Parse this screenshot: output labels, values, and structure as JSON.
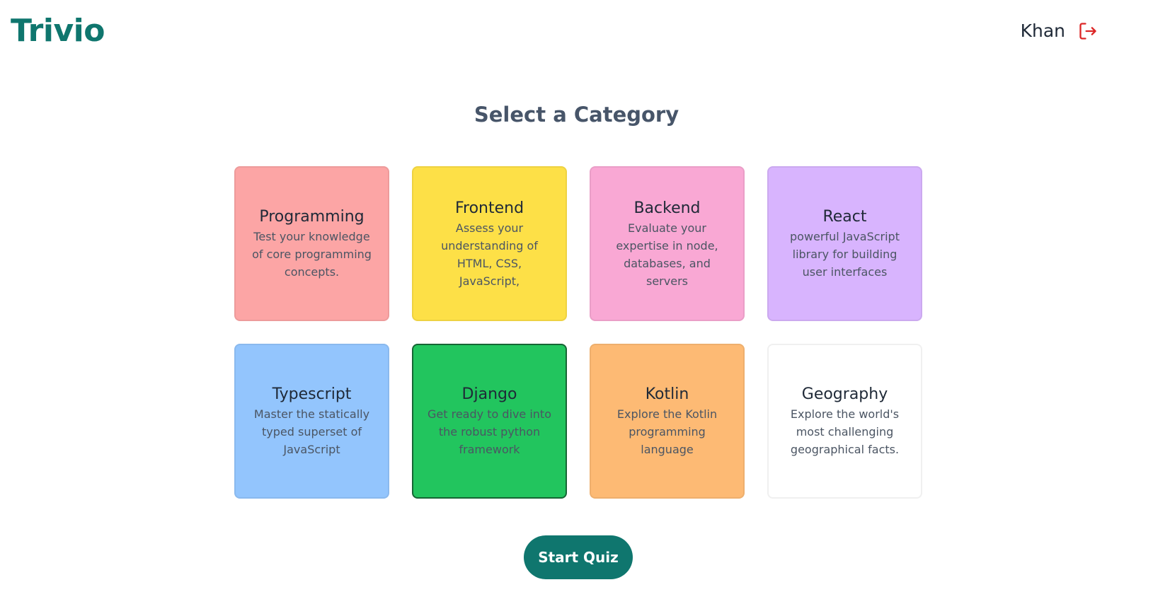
{
  "header": {
    "logo": "Trivio",
    "user_name": "Khan",
    "logout_icon": "logout-icon",
    "logo_color": "#0f766e",
    "logout_color": "#dc2626"
  },
  "main": {
    "title": "Select a Category",
    "categories": [
      {
        "title": "Programming",
        "description": "Test your knowledge of core programming concepts.",
        "color": "#fca5a5",
        "selected": false
      },
      {
        "title": "Frontend",
        "description": "Assess your understanding of HTML, CSS, JavaScript,",
        "color": "#fde047",
        "selected": false
      },
      {
        "title": "Backend",
        "description": "Evaluate your expertise in node, databases, and servers",
        "color": "#f9a8d4",
        "selected": false
      },
      {
        "title": "React",
        "description": "powerful JavaScript library for building user interfaces",
        "color": "#d8b4fe",
        "selected": false
      },
      {
        "title": "Typescript",
        "description": "Master the statically typed superset of JavaScript",
        "color": "#93c5fd",
        "selected": false
      },
      {
        "title": "Django",
        "description": "Get ready to dive into the robust python framework",
        "color": "#22c55e",
        "selected": true
      },
      {
        "title": "Kotlin",
        "description": "Explore the Kotlin programming language",
        "color": "#fdba74",
        "selected": false
      },
      {
        "title": "Geography",
        "description": "Explore the world's most challenging geographical facts.",
        "color": "#ffffff",
        "selected": false
      }
    ],
    "start_button": "Start Quiz"
  }
}
